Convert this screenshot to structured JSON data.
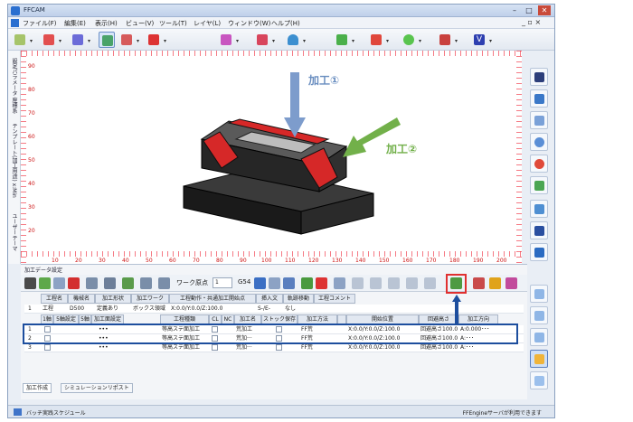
{
  "window": {
    "title": "FFCAM",
    "min": "–",
    "max": "□",
    "close": "✕"
  },
  "menu": {
    "items": [
      "ファイル(F)",
      "編集(E)",
      "表示(H)",
      "ビュー(V)",
      "ツール(T)",
      "レイヤ(L)",
      "ウィンドウ(W)",
      "ヘルプ(H)"
    ],
    "mdi": "_ ▫ ×"
  },
  "left_ruler": {
    "labels": [
      "設定パラメータ 座標系",
      "テンプレート(加工用途) x:Min",
      "ユーザーテーマ"
    ]
  },
  "viewport": {
    "x_ticks": [
      "10",
      "20",
      "30",
      "40",
      "50",
      "60",
      "70",
      "80",
      "90",
      "100",
      "110",
      "120",
      "130",
      "140",
      "150",
      "160",
      "170",
      "180",
      "190",
      "200"
    ],
    "y_ticks": [
      "90",
      "80",
      "70",
      "60",
      "50",
      "40",
      "30",
      "20"
    ]
  },
  "annotations": {
    "op1": "加工①",
    "op2": "加工②"
  },
  "panel": {
    "title": "加工データ設定",
    "work_origin_label": "ワーク原点",
    "work_origin_value": "1",
    "g54": "G54",
    "row_header": [
      "工程名",
      "機械名",
      "加工形状",
      "加工ワーク",
      "工程動作・共通加工開始点",
      "挿入文",
      "軌跡移動",
      "工程コメント"
    ],
    "process_row": {
      "no": "1",
      "name": "工程",
      "machine": "D500",
      "shape": "定義あり",
      "work": "ボックス領域",
      "start": "X:0.0/Y:0.0/Z:100.0",
      "insert": "S-/E-",
      "move": "なし"
    },
    "columns": [
      "1軸",
      "5軸設定",
      "5軸",
      "加工面設定",
      "工程種類",
      "CL",
      "NC",
      "加工名",
      "ストック保存",
      "加工方法",
      "",
      "開始位置",
      "回避高さ",
      "加工方向"
    ],
    "rows": [
      {
        "no": "1",
        "dots": "•••",
        "type": "等高ステ面加工",
        "name": "荒加工",
        "method": "FF荒",
        "start": "X:0.0/Y:0.0/Z:100.0",
        "avoid": "回避高さ100.0",
        "dir": "A:0.000･･･"
      },
      {
        "no": "2",
        "dots": "•••",
        "type": "等高ステ面加工",
        "name": "荒加···",
        "method": "FF荒",
        "start": "X:0.0/Y:0.0/Z:100.0",
        "avoid": "回避高さ100.0",
        "dir": "A:･･･"
      },
      {
        "no": "3",
        "dots": "•••",
        "type": "等高ステ面加工",
        "name": "荒加···",
        "method": "FF荒",
        "start": "X:0.0/Y:0.0/Z:100.0",
        "avoid": "回避高さ100.0",
        "dir": "A:･･･"
      }
    ]
  },
  "bottom_tabs": [
    "加工作成",
    "シミュレーションリポスト"
  ],
  "status": {
    "left": "バッチ実践スケジュール",
    "right": "FFEngineサーバが利用できます"
  },
  "colors": {
    "accent_green": "#72b04a",
    "arrow_blue": "#7d9ccc",
    "highlight_red": "#e03030",
    "select_blue": "#1d4e9e"
  }
}
